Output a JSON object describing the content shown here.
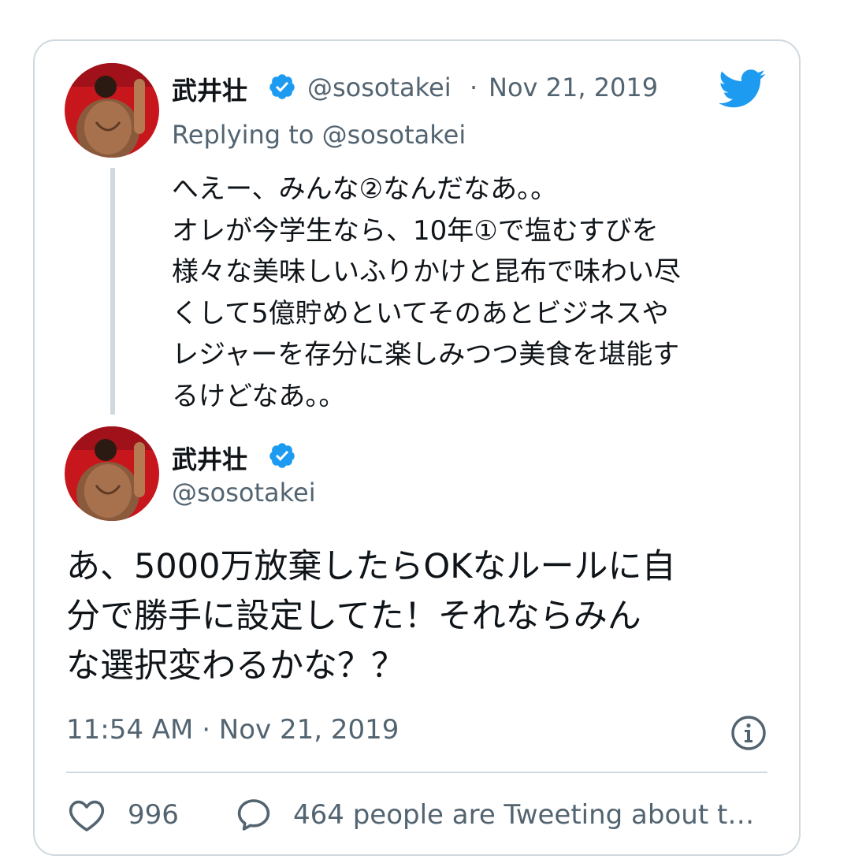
{
  "quoted_tweet": {
    "display_name": "武井壮",
    "handle": "@sosotakei",
    "separator": "·",
    "date": "Nov 21, 2019",
    "replying_to": "Replying to @sosotakei",
    "text": "へえー、みんな②なんだなあ。。\nオレが今学生なら、10年①で塩むすびを\n様々な美味しいふりかけと昆布で味わい尽\nくして5億貯めといてそのあとビジネスや\nレジャーを存分に楽しみつつ美食を堪能す\nるけどなあ。。"
  },
  "main_tweet": {
    "display_name": "武井壮",
    "handle": "@sosotakei",
    "text": "あ、5000万放棄したらOKなルールに自\n分で勝手に設定してた！それならみん\nな選択変わるかな？？",
    "timestamp": "11:54 AM · Nov 21, 2019"
  },
  "actions": {
    "like_count": "996",
    "reply_text": "464 people are Tweeting about t…"
  },
  "icons": {
    "verified": "verified-badge-icon",
    "brand": "twitter-bird-icon",
    "info": "info-icon",
    "like": "heart-icon",
    "comment": "speech-bubble-icon"
  },
  "colors": {
    "brand_blue": "#1d9bf0",
    "text_primary": "#0f1419",
    "text_secondary": "#536471",
    "border": "#cfd9de"
  }
}
